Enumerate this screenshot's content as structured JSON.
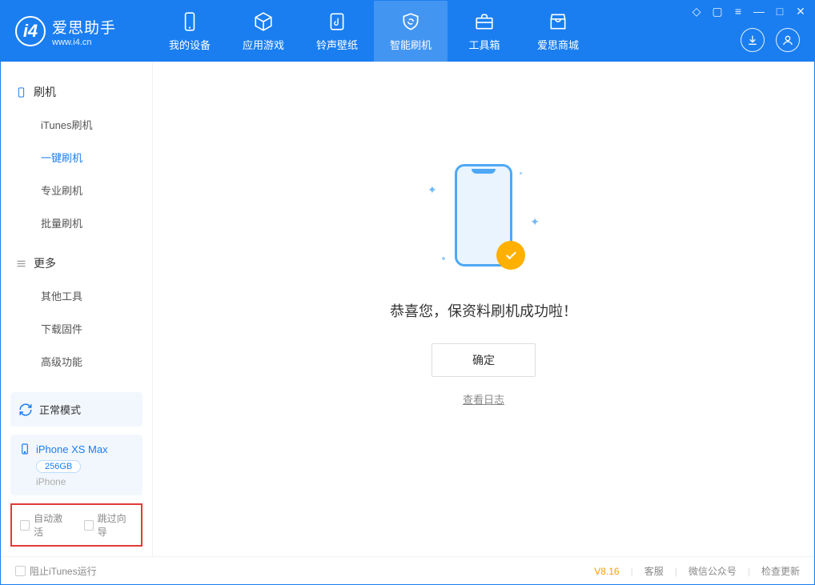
{
  "app": {
    "title": "爱思助手",
    "subtitle": "www.i4.cn"
  },
  "nav": {
    "device": "我的设备",
    "apps": "应用游戏",
    "ringtone": "铃声壁纸",
    "flash": "智能刷机",
    "toolbox": "工具箱",
    "store": "爱思商城"
  },
  "sidebar": {
    "flash_header": "刷机",
    "items": {
      "itunes": "iTunes刷机",
      "onekey": "一键刷机",
      "pro": "专业刷机",
      "batch": "批量刷机"
    },
    "more_header": "更多",
    "more_items": {
      "other": "其他工具",
      "firmware": "下载固件",
      "advanced": "高级功能"
    },
    "mode": "正常模式",
    "device": {
      "name": "iPhone XS Max",
      "storage": "256GB",
      "type": "iPhone"
    },
    "checks": {
      "auto_activate": "自动激活",
      "skip_guide": "跳过向导"
    }
  },
  "main": {
    "success": "恭喜您，保资料刷机成功啦！",
    "ok": "确定",
    "view_log": "查看日志"
  },
  "footer": {
    "block_itunes": "阻止iTunes运行",
    "version": "V8.16",
    "service": "客服",
    "wechat": "微信公众号",
    "update": "检查更新"
  }
}
